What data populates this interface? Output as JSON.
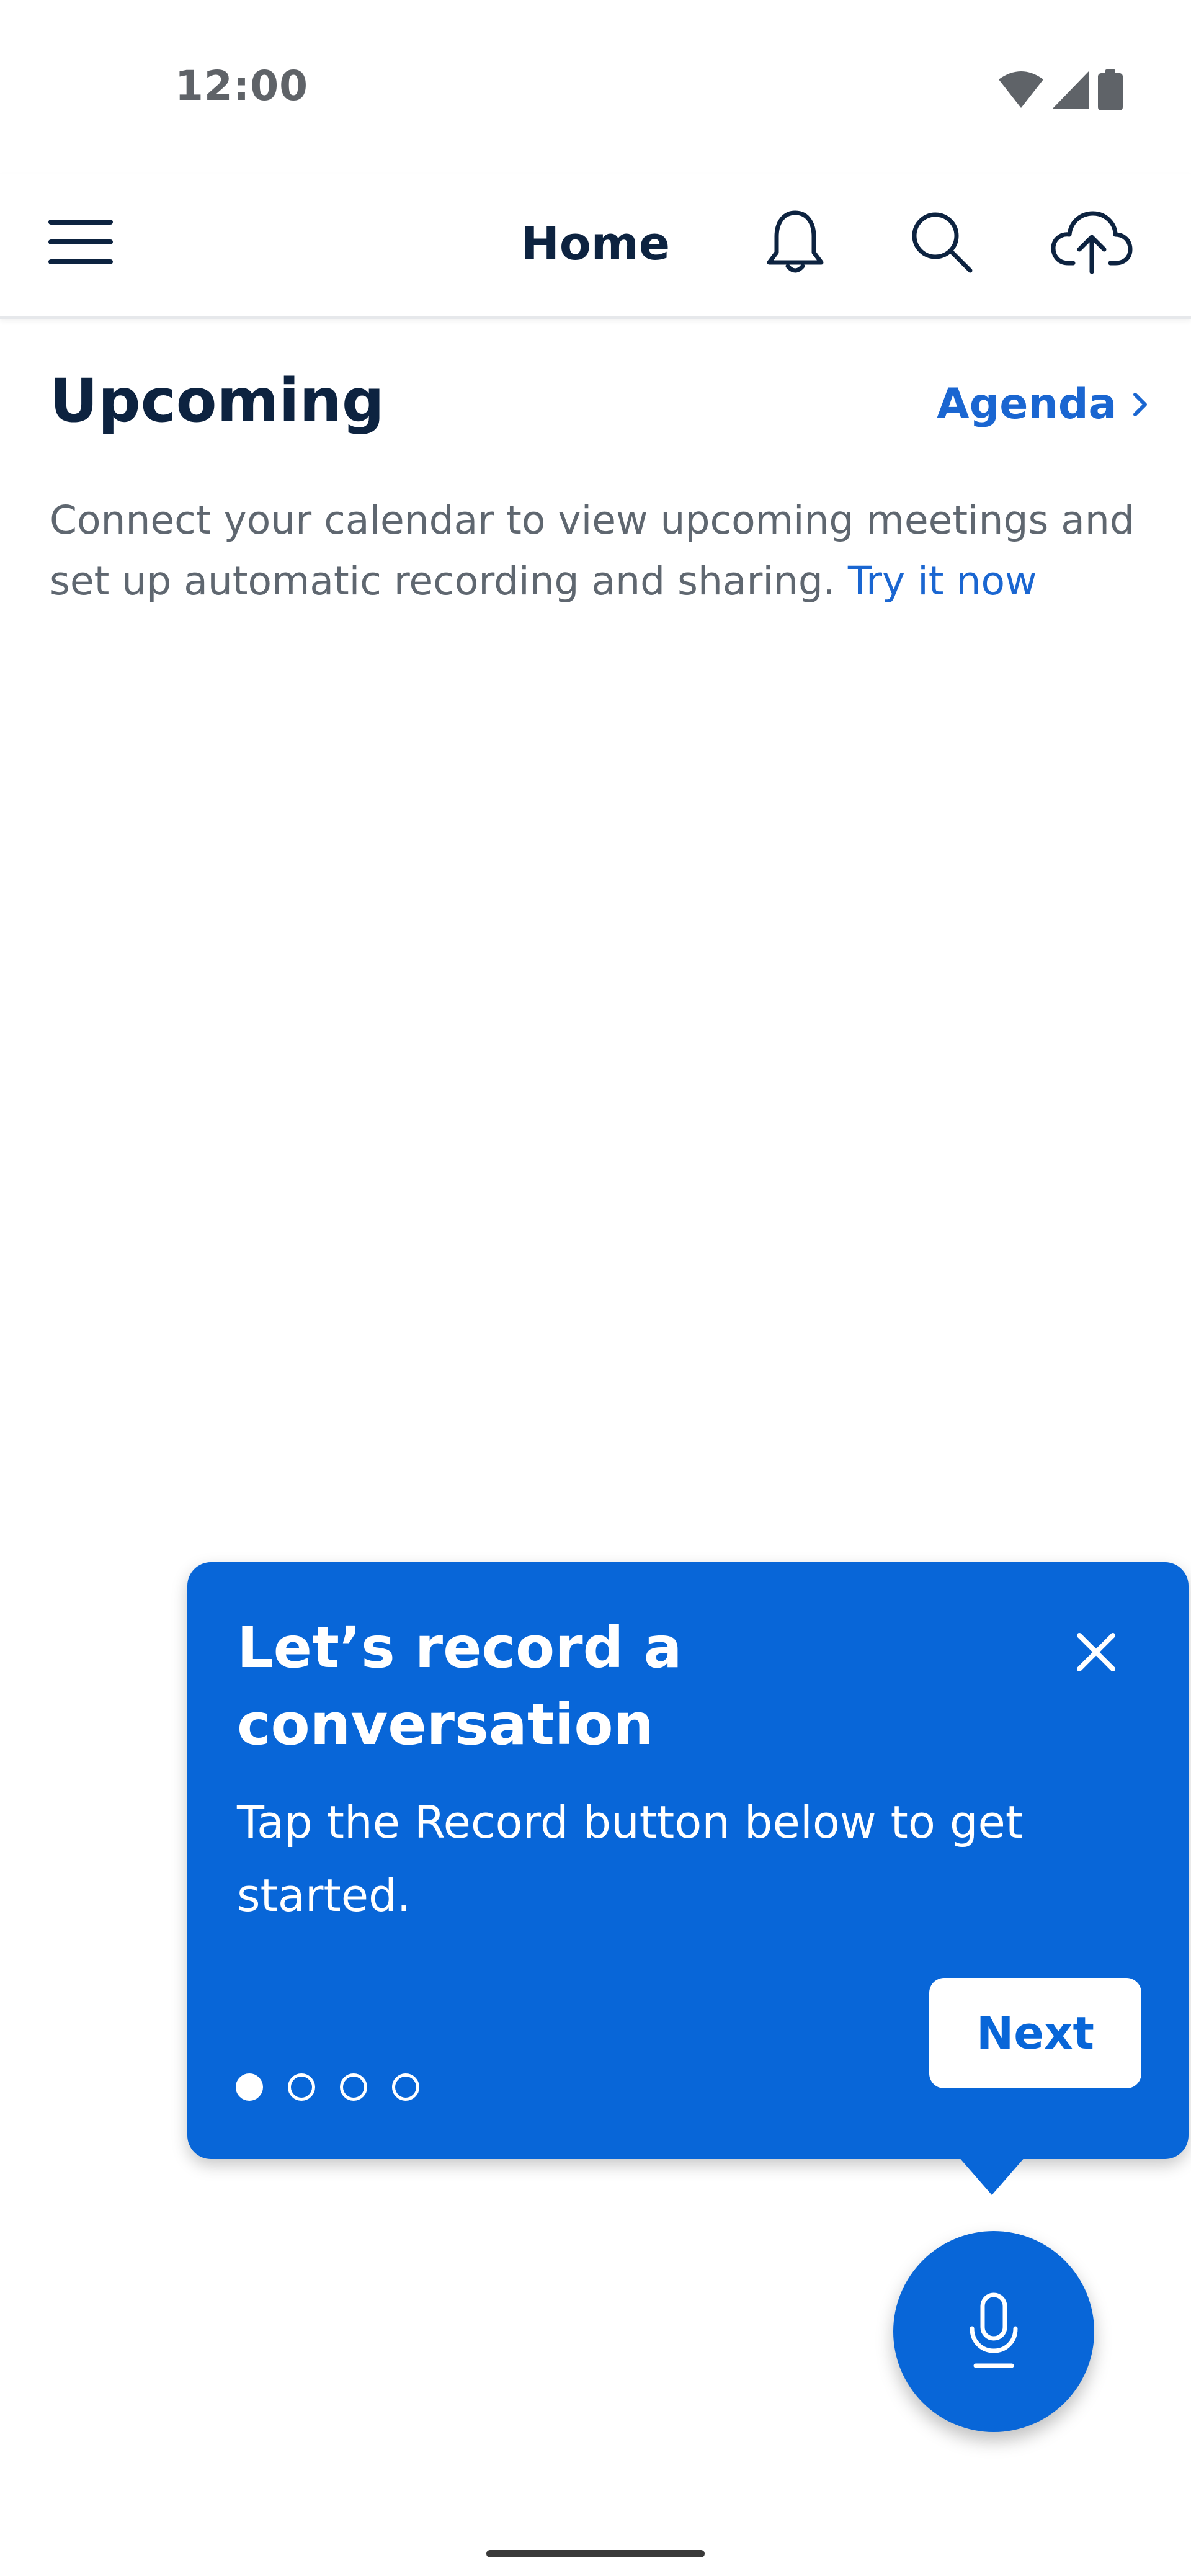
{
  "status_bar": {
    "time": "12:00",
    "icons": [
      "wifi-icon",
      "signal-icon",
      "battery-icon"
    ]
  },
  "app_bar": {
    "title": "Home",
    "icons": [
      "menu-icon",
      "bell-icon",
      "search-icon",
      "cloud-upload-icon"
    ]
  },
  "upcoming": {
    "title": "Upcoming",
    "agenda_label": "Agenda",
    "description": "Connect your calendar to view upcoming meetings and set up automatic recording and sharing. ",
    "try_link": "Try it now"
  },
  "tooltip": {
    "title": "Let’s record a conversation",
    "body": "Tap the Record button below to get started.",
    "next_label": "Next",
    "steps_total": 4,
    "current_step": 1
  },
  "fab": {
    "icon": "microphone-icon"
  },
  "colors": {
    "accent": "#0866d8",
    "link": "#1a66d1",
    "text_dark": "#0d2340",
    "text_muted": "#5f6770"
  }
}
